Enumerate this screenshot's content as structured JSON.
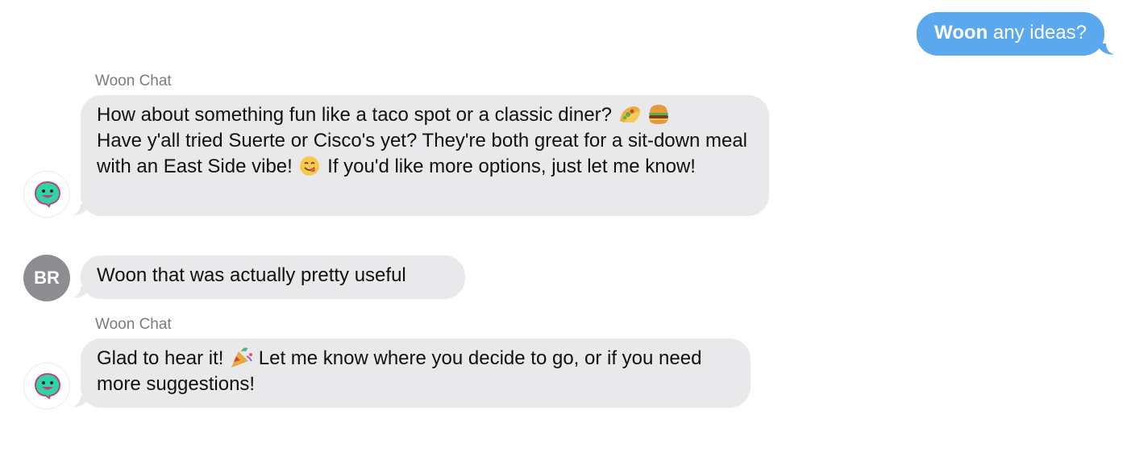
{
  "outgoing": {
    "mention": "Woon",
    "rest": " any ideas?"
  },
  "messages": [
    {
      "sender": "Woon Chat",
      "parts": [
        "How about something fun like a taco spot or a classic diner?",
        "Have y'all tried Suerte or Cisco's yet? They're both great for a sit-down meal with an East Side vibe!",
        "If you'd like more options, just let me know!"
      ]
    },
    {
      "avatar_initials": "BR",
      "text": "Woon that was actually pretty useful"
    },
    {
      "sender": "Woon Chat",
      "parts": [
        "Glad to hear it!",
        "Let me know where you decide to go, or if you need more suggestions!"
      ]
    }
  ],
  "colors": {
    "outgoing_bubble": "#5ba8ef",
    "incoming_bubble": "#e9e9eb",
    "bot_avatar_face": "#2dd4a7",
    "user_avatar": "#8c8c91"
  },
  "icons": [
    "taco-emoji",
    "hamburger-emoji",
    "yum-face-emoji",
    "party-popper-emoji",
    "woon-bot-icon"
  ]
}
